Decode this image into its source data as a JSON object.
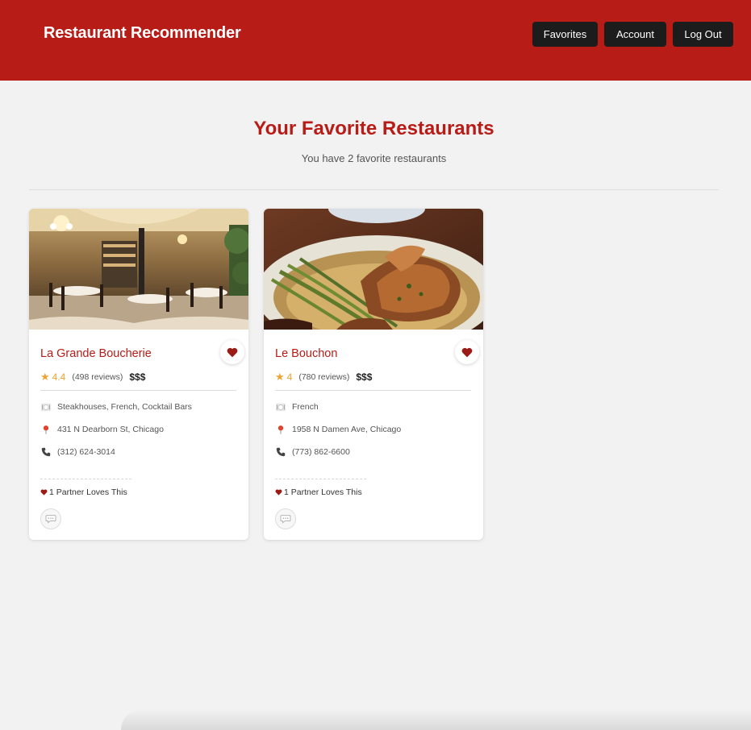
{
  "header": {
    "title": "Restaurant Recommender",
    "nav": [
      {
        "label": "Favorites"
      },
      {
        "label": "Account"
      },
      {
        "label": "Log Out"
      }
    ]
  },
  "page": {
    "title": "Your Favorite Restaurants",
    "subtitle": "You have 2 favorite restaurants"
  },
  "restaurants": [
    {
      "name": "La Grande Boucherie",
      "rating": "4.4",
      "reviews": "(498 reviews)",
      "price": "$$$",
      "categories": "Steakhouses, French, Cocktail Bars",
      "address": "431 N Dearborn St, Chicago",
      "phone": "(312) 624-3014",
      "partner_text": "1 Partner Loves This",
      "favorited": true
    },
    {
      "name": "Le Bouchon",
      "rating": "4",
      "reviews": "(780 reviews)",
      "price": "$$$",
      "categories": "French",
      "address": "1958 N Damen Ave, Chicago",
      "phone": "(773) 862-6600",
      "partner_text": "1 Partner Loves This",
      "favorited": true
    }
  ],
  "icons": {
    "categories": "utensils-icon",
    "address": "map-pin-icon",
    "phone": "phone-icon",
    "favorite": "heart-icon",
    "comment": "comment-icon"
  },
  "colors": {
    "brand": "#b71c17",
    "nav_button": "#1c1c1c",
    "star": "#f0a330",
    "background": "#f2f2f2"
  }
}
